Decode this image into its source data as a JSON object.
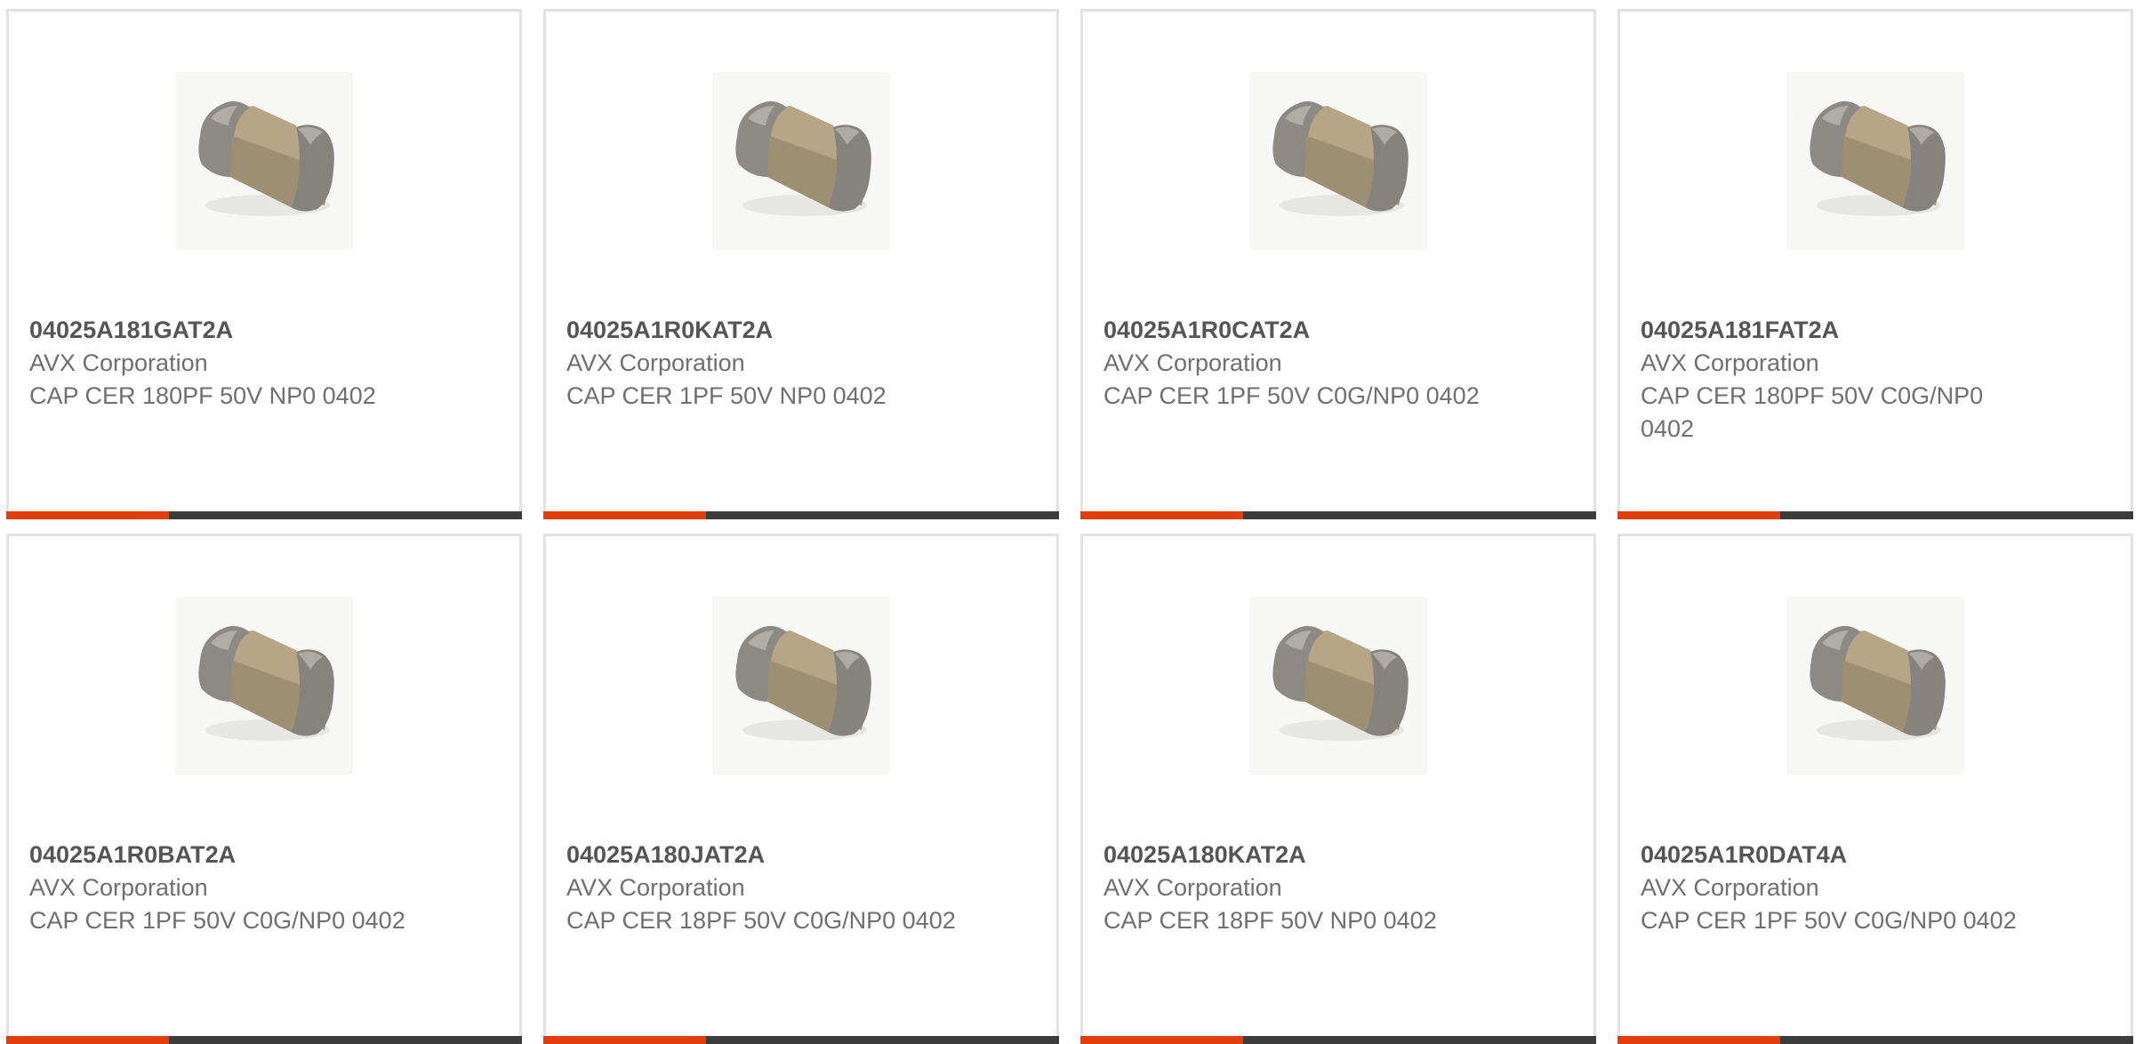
{
  "colors": {
    "accent": "#e23d0b",
    "bar": "#3c3c3c",
    "text": "#6f6f6f",
    "border": "#e2e2e2"
  },
  "products": [
    {
      "part_number": "04025A181GAT2A",
      "manufacturer": "AVX Corporation",
      "description": "CAP CER 180PF 50V NP0 0402",
      "image_icon": "ceramic-capacitor-chip-icon"
    },
    {
      "part_number": "04025A1R0KAT2A",
      "manufacturer": "AVX Corporation",
      "description": "CAP CER 1PF 50V NP0 0402",
      "image_icon": "ceramic-capacitor-chip-icon"
    },
    {
      "part_number": "04025A1R0CAT2A",
      "manufacturer": "AVX Corporation",
      "description": "CAP CER 1PF 50V C0G/NP0 0402",
      "image_icon": "ceramic-capacitor-chip-icon"
    },
    {
      "part_number": "04025A181FAT2A",
      "manufacturer": "AVX Corporation",
      "description": "CAP CER 180PF 50V C0G/NP0 0402",
      "image_icon": "ceramic-capacitor-chip-icon"
    },
    {
      "part_number": "04025A1R0BAT2A",
      "manufacturer": "AVX Corporation",
      "description": "CAP CER 1PF 50V C0G/NP0 0402",
      "image_icon": "ceramic-capacitor-chip-icon"
    },
    {
      "part_number": "04025A180JAT2A",
      "manufacturer": "AVX Corporation",
      "description": "CAP CER 18PF 50V C0G/NP0 0402",
      "image_icon": "ceramic-capacitor-chip-icon"
    },
    {
      "part_number": "04025A180KAT2A",
      "manufacturer": "AVX Corporation",
      "description": "CAP CER 18PF 50V NP0 0402",
      "image_icon": "ceramic-capacitor-chip-icon"
    },
    {
      "part_number": "04025A1R0DAT4A",
      "manufacturer": "AVX Corporation",
      "description": "CAP CER 1PF 50V C0G/NP0 0402",
      "image_icon": "ceramic-capacitor-chip-icon"
    }
  ]
}
